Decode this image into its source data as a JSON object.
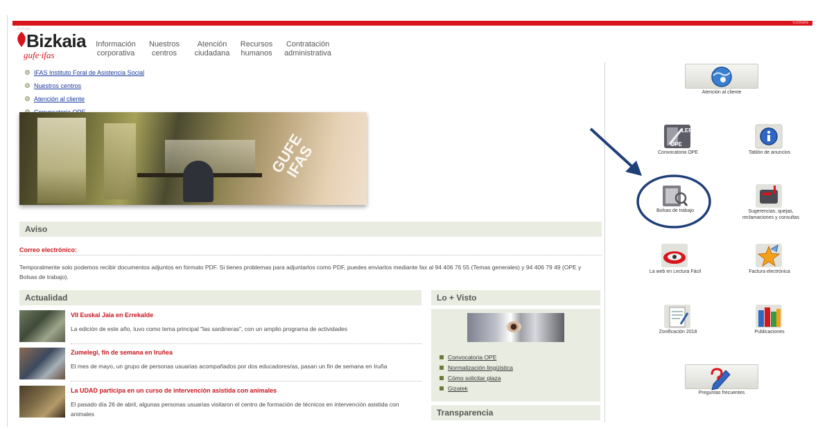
{
  "top_bar": {
    "left": "Bizkaia",
    "right": "Euskara"
  },
  "logo": {
    "word": "Bizkaia",
    "sub": "gufe·ifas"
  },
  "top_nav": [
    {
      "line1": "Información",
      "line2": "corporativa"
    },
    {
      "line1": "Nuestros",
      "line2": "centros"
    },
    {
      "line1": "Atención",
      "line2": "ciudadana"
    },
    {
      "line1": "Recursos",
      "line2": "humanos"
    },
    {
      "line1": "Contratación",
      "line2": "administrativa"
    }
  ],
  "side_links": [
    "IFAS Instituto Foral de Asistencia Social",
    "Nuestros centros",
    "Atención al cliente",
    "Convocatoria OPE"
  ],
  "banner": {
    "brand1": "GUFE",
    "brand2": "IFAS"
  },
  "aviso": {
    "title": "Aviso",
    "subtitle": "Correo electrónico:",
    "text": "Temporalmente solo podemos recibir documentos adjuntos en formato PDF. Si tienes problemas para adjuntarlos como PDF, puedes enviarlos mediante fax al 94 406 76 55 (Temas generales) y 94 406 79 49 (OPE y Bolsas de trabajo)."
  },
  "actualidad": {
    "title": "Actualidad",
    "items": [
      {
        "title": "VII Euskal Jaia en Errekalde",
        "desc": "La edición de este año, tuvo como tema principal \"las sardineras\", con un amplio programa de actividades"
      },
      {
        "title": "Zumelegi, fin de semana en Iruñea",
        "desc": "El mes de mayo, un grupo de personas usuarias acompañados por dos educadores/as, pasan un fin de semana en Iruña"
      },
      {
        "title": "La UDAD participa en un curso de intervención asistida con animales",
        "desc": "El pasado día 26 de abril, algunas personas usuarias visitaron el centro de formación de técnicos en intervención asistida con animales"
      }
    ]
  },
  "lo_visto": {
    "title": "Lo + Visto",
    "links": [
      "Convocatoria OPE",
      "Normalización lingüística",
      "Cómo solicitar plaza",
      "Gizatek"
    ]
  },
  "transparencia": {
    "title": "Transparencia"
  },
  "right_panel": {
    "atencion": "Atención al cliente",
    "convocatoria": "Convocatoria OPE",
    "tablon": "Tablón de anuncios",
    "bolsas": "Bolsas de trabajo",
    "sugerencias": "Sugerencias, quejas, reclamaciones y consultas",
    "lectura": "La web en Lectura Fácil",
    "factura": "Factura electrónica",
    "zonificacion": "Zonificación 2018",
    "publicaciones": "Publicaciones",
    "preguntas": "Preguntas frecuentes",
    "lep_badge": "LEP",
    "ope_badge": "OPE"
  },
  "colors": {
    "brand_red": "#d8141c",
    "annotation_blue": "#1f3f7a",
    "section_bg": "#e9ede1"
  }
}
